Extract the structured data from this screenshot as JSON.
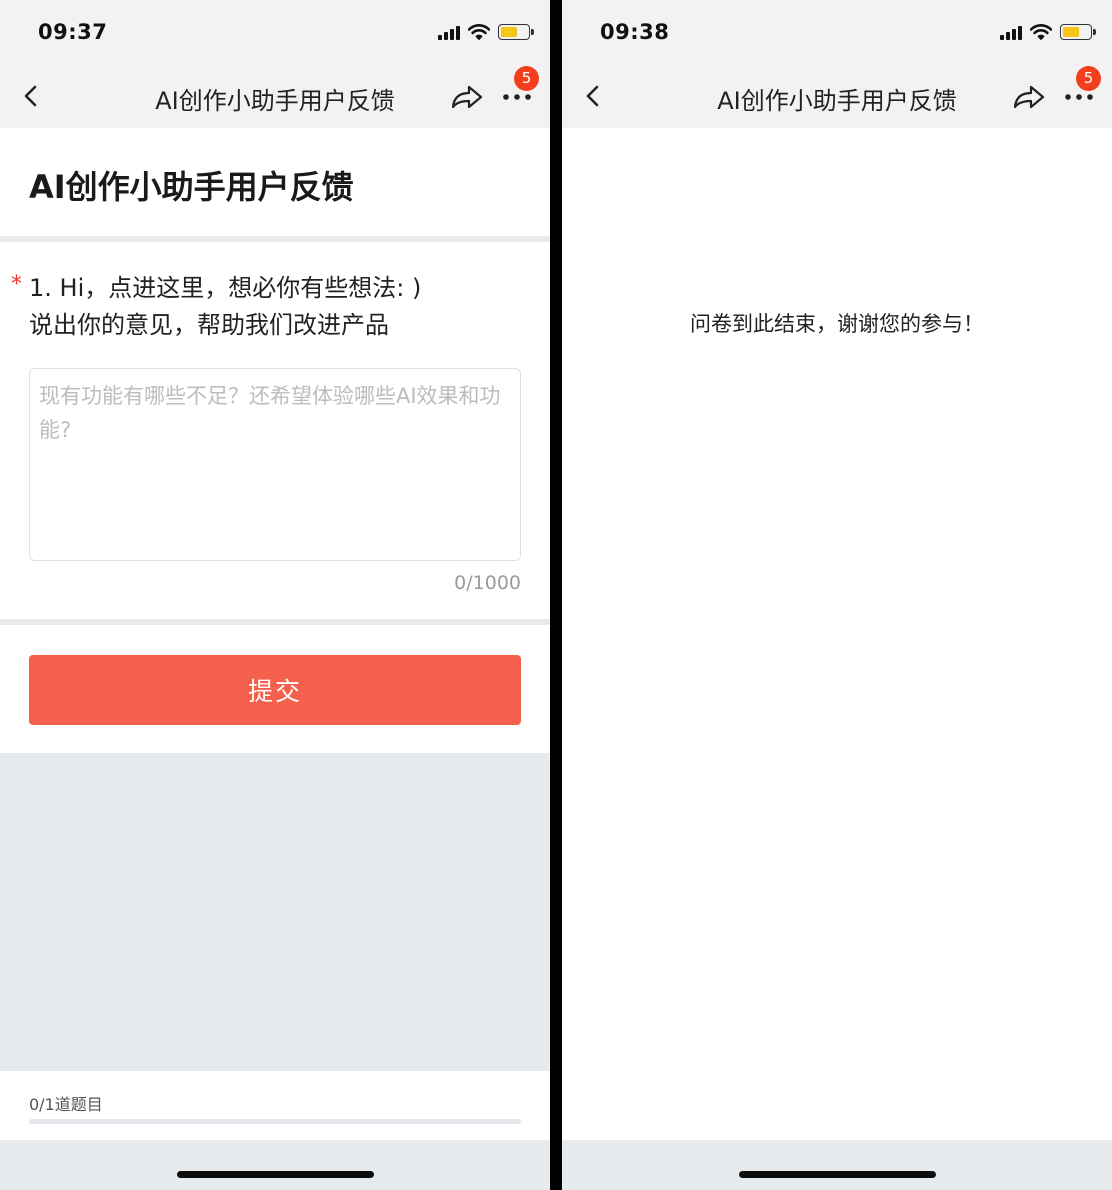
{
  "left_screen": {
    "status": {
      "time": "09:37"
    },
    "nav": {
      "title": "AI创作小助手用户反馈",
      "badge_count": "5"
    },
    "form": {
      "title": "AI创作小助手用户反馈",
      "question": {
        "required_mark": "*",
        "line1": "1. Hi，点进这里，想必你有些想法: )",
        "line2": "说出你的意见，帮助我们改进产品",
        "placeholder": "现有功能有哪些不足？还希望体验哪些AI效果和功能?",
        "value": "",
        "char_count": "0/1000"
      },
      "submit_label": "提交",
      "progress": {
        "label": "0/1道题目",
        "fraction": 0
      }
    }
  },
  "right_screen": {
    "status": {
      "time": "09:38"
    },
    "nav": {
      "title": "AI创作小助手用户反馈",
      "badge_count": "5"
    },
    "end_message": "问卷到此结束，谢谢您的参与！"
  },
  "colors": {
    "accent": "#f4604b",
    "badge": "#f2401e",
    "battery": "#f5c518",
    "page_bg": "#e8ebee"
  },
  "icons": [
    "signal-icon",
    "wifi-icon",
    "battery-icon",
    "back-chevron-icon",
    "share-icon",
    "more-dots-icon"
  ]
}
